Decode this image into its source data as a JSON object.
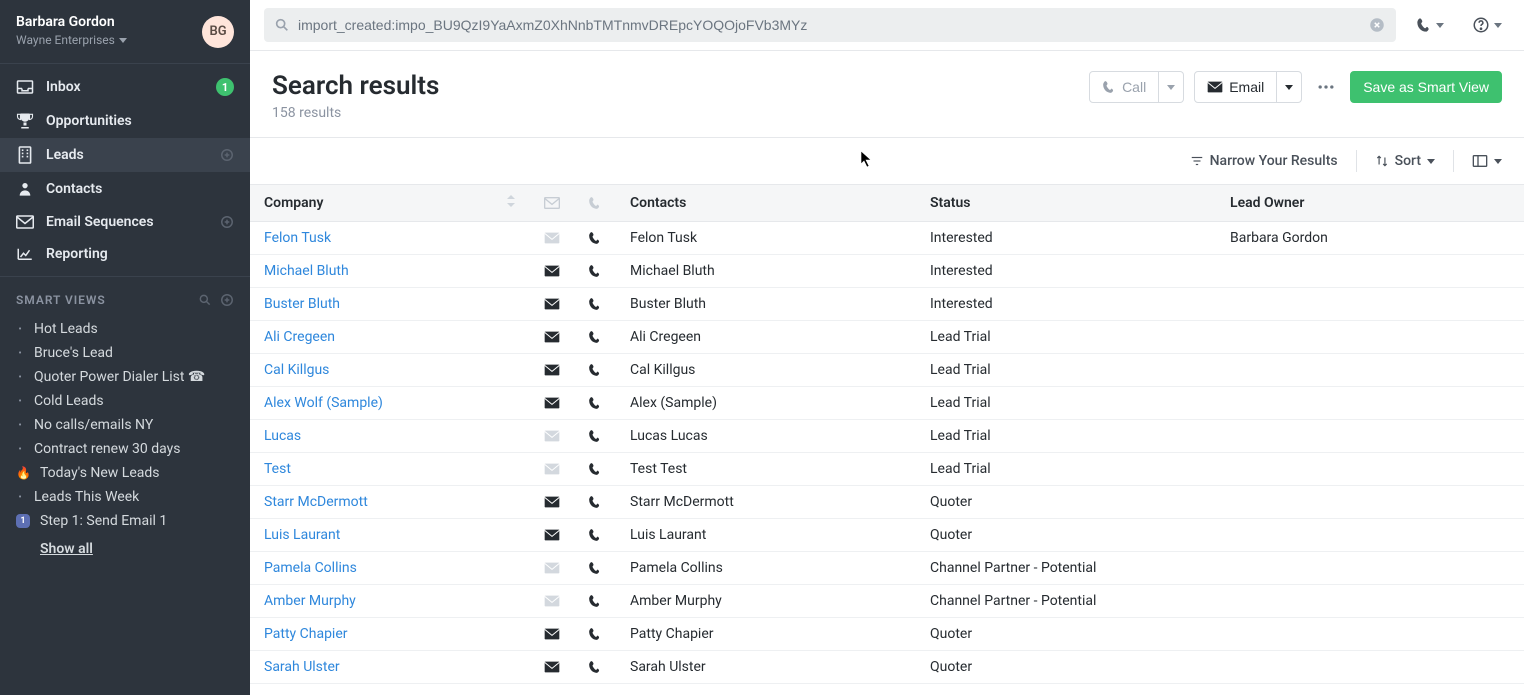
{
  "user": {
    "name": "Barbara Gordon",
    "org": "Wayne Enterprises",
    "avatar_initials": "BG"
  },
  "sidebar": {
    "nav": [
      {
        "label": "Inbox",
        "icon": "inbox",
        "badge": "1"
      },
      {
        "label": "Opportunities",
        "icon": "trophy"
      },
      {
        "label": "Leads",
        "icon": "building",
        "active": true,
        "add": true
      },
      {
        "label": "Contacts",
        "icon": "user"
      },
      {
        "label": "Email Sequences",
        "icon": "envelope",
        "add": true
      },
      {
        "label": "Reporting",
        "icon": "chart"
      }
    ],
    "smart_views": {
      "title": "SMART VIEWS",
      "items": [
        {
          "label": "Hot Leads",
          "bullet": "dot"
        },
        {
          "label": "Bruce's Lead",
          "bullet": "dot"
        },
        {
          "label": "Quoter Power Dialer List ☎",
          "bullet": "dot"
        },
        {
          "label": "Cold Leads",
          "bullet": "dot"
        },
        {
          "label": "No calls/emails NY",
          "bullet": "dot"
        },
        {
          "label": "Contract renew 30 days",
          "bullet": "dot"
        },
        {
          "label": "Today's New Leads",
          "bullet": "emoji",
          "emoji": "🔥"
        },
        {
          "label": "Leads This Week",
          "bullet": "dot"
        },
        {
          "label": "Step 1: Send Email 1",
          "bullet": "square",
          "square": "1"
        }
      ],
      "show_all": "Show all"
    }
  },
  "search": {
    "value": "import_created:impo_BU9QzI9YaAxmZ0XhNnbTMTnmvDREpcYOQOjoFVb3MYz"
  },
  "header": {
    "title": "Search results",
    "sub": "158 results",
    "call_label": "Call",
    "email_label": "Email",
    "save_label": "Save as Smart View"
  },
  "filter_bar": {
    "narrow": "Narrow Your Results",
    "sort": "Sort"
  },
  "table": {
    "columns": {
      "company": "Company",
      "contacts": "Contacts",
      "status": "Status",
      "owner": "Lead Owner"
    },
    "rows": [
      {
        "company": "Felon Tusk",
        "email": "muted",
        "phone": "on",
        "contact": "Felon Tusk",
        "status": "Interested",
        "owner": "Barbara Gordon"
      },
      {
        "company": "Michael Bluth",
        "email": "on",
        "phone": "on",
        "contact": "Michael Bluth",
        "status": "Interested",
        "owner": ""
      },
      {
        "company": "Buster Bluth",
        "email": "on",
        "phone": "on",
        "contact": "Buster Bluth",
        "status": "Interested",
        "owner": ""
      },
      {
        "company": "Ali Cregeen",
        "email": "on",
        "phone": "on",
        "contact": "Ali Cregeen",
        "status": "Lead Trial",
        "owner": ""
      },
      {
        "company": "Cal Killgus",
        "email": "on",
        "phone": "on",
        "contact": "Cal Killgus",
        "status": "Lead Trial",
        "owner": ""
      },
      {
        "company": "Alex Wolf (Sample)",
        "email": "on",
        "phone": "on",
        "contact": "Alex (Sample)",
        "status": "Lead Trial",
        "owner": ""
      },
      {
        "company": "Lucas",
        "email": "muted",
        "phone": "on",
        "contact": "Lucas Lucas",
        "status": "Lead Trial",
        "owner": ""
      },
      {
        "company": "Test",
        "email": "muted",
        "phone": "on",
        "contact": "Test Test",
        "status": "Lead Trial",
        "owner": ""
      },
      {
        "company": "Starr McDermott",
        "email": "on",
        "phone": "on",
        "contact": "Starr McDermott",
        "status": "Quoter",
        "owner": ""
      },
      {
        "company": "Luis Laurant",
        "email": "on",
        "phone": "on",
        "contact": "Luis Laurant",
        "status": "Quoter",
        "owner": ""
      },
      {
        "company": "Pamela Collins",
        "email": "muted",
        "phone": "on",
        "contact": "Pamela Collins",
        "status": "Channel Partner - Potential",
        "owner": ""
      },
      {
        "company": "Amber Murphy",
        "email": "muted",
        "phone": "on",
        "contact": "Amber Murphy",
        "status": "Channel Partner - Potential",
        "owner": ""
      },
      {
        "company": "Patty Chapier",
        "email": "on",
        "phone": "on",
        "contact": "Patty Chapier",
        "status": "Quoter",
        "owner": ""
      },
      {
        "company": "Sarah Ulster",
        "email": "on",
        "phone": "on",
        "contact": "Sarah Ulster",
        "status": "Quoter",
        "owner": ""
      }
    ]
  }
}
